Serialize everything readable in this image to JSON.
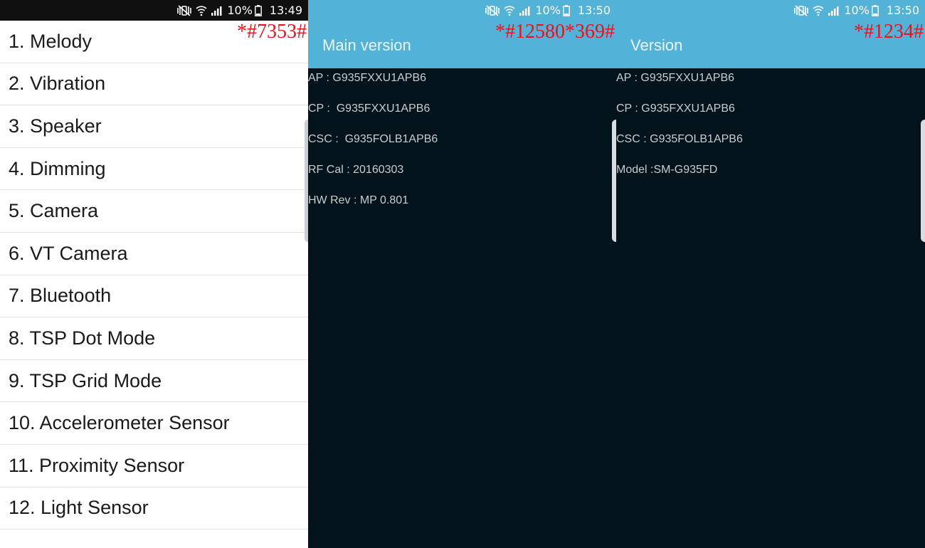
{
  "panels": {
    "melody": {
      "status": {
        "battery": "10%",
        "time": "13:49"
      },
      "code": "*#7353#",
      "items": [
        "1. Melody",
        "2. Vibration",
        "3. Speaker",
        "4. Dimming",
        "5. Camera",
        "6. VT Camera",
        "7. Bluetooth",
        "8. TSP Dot Mode",
        "9. TSP Grid Mode",
        "10. Accelerometer Sensor",
        "11. Proximity Sensor",
        "12. Light Sensor"
      ]
    },
    "main_version": {
      "status": {
        "battery": "10%",
        "time": "13:50"
      },
      "code": "*#12580*369#",
      "title": "Main version",
      "lines": [
        "AP : G935FXXU1APB6",
        "CP :  G935FXXU1APB6",
        "CSC :  G935FOLB1APB6",
        "RF Cal : 20160303",
        "HW Rev : MP 0.801"
      ]
    },
    "version": {
      "status": {
        "battery": "10%",
        "time": "13:50"
      },
      "code": "*#1234#",
      "title": "Version",
      "lines": [
        "AP : G935FXXU1APB6",
        "CP : G935FXXU1APB6",
        "CSC : G935FOLB1APB6",
        "Model :SM-G935FD"
      ]
    }
  },
  "icons": [
    "mute-vibrate-icon",
    "wifi-icon",
    "signal-icon",
    "battery-icon"
  ],
  "colors": {
    "appbar": "#53b2d7",
    "code_label": "#e8121c",
    "dark_bg": "#03131b"
  }
}
